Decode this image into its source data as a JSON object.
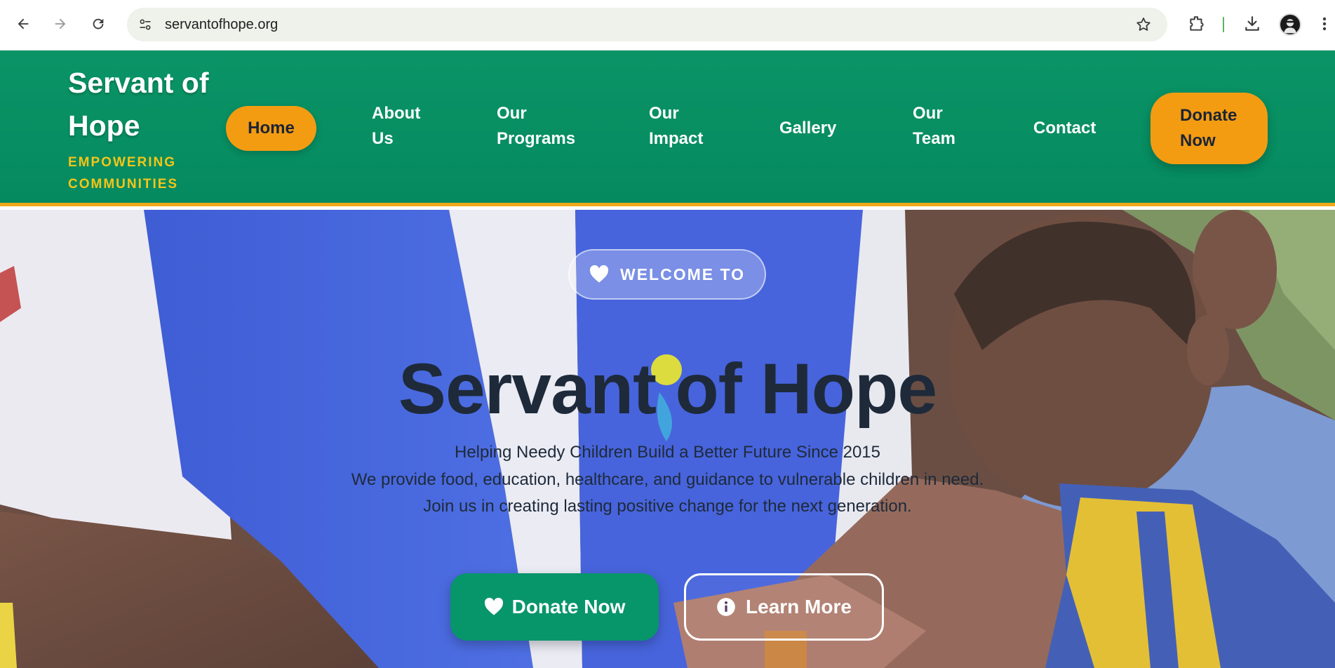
{
  "browser": {
    "url": "servantofhope.org",
    "icons": [
      "back-arrow-icon",
      "forward-arrow-icon",
      "reload-icon",
      "site-info-icon",
      "bookmark-star-icon",
      "extensions-icon",
      "download-icon",
      "profile-avatar",
      "more-menu-icon"
    ]
  },
  "header": {
    "brand_title": "Servant of Hope",
    "brand_tagline": "EMPOWERING COMMUNITIES",
    "nav": {
      "home": "Home",
      "about_1": "About",
      "about_2": "Us",
      "programs_1": "Our",
      "programs_2": "Programs",
      "impact_1": "Our",
      "impact_2": "Impact",
      "gallery": "Gallery",
      "team_1": "Our",
      "team_2": "Team",
      "contact": "Contact"
    },
    "donate_1": "Donate",
    "donate_2": "Now"
  },
  "hero": {
    "welcome": "WELCOME TO",
    "title": "Servant of Hope",
    "line1": "Helping Needy Children Build a Better Future Since 2015",
    "line2": "We provide food, education, healthcare, and guidance to vulnerable children in need.",
    "line3": "Join us in creating lasting positive change for the next generation.",
    "donate_button": "Donate Now",
    "learn_button": "Learn More"
  },
  "colors": {
    "header_green": "#0a9466",
    "accent_orange": "#f39c12",
    "tagline_yellow": "#f5c518",
    "dark_text": "#1e2a3a",
    "omnibox_bg": "#eef2ea"
  }
}
